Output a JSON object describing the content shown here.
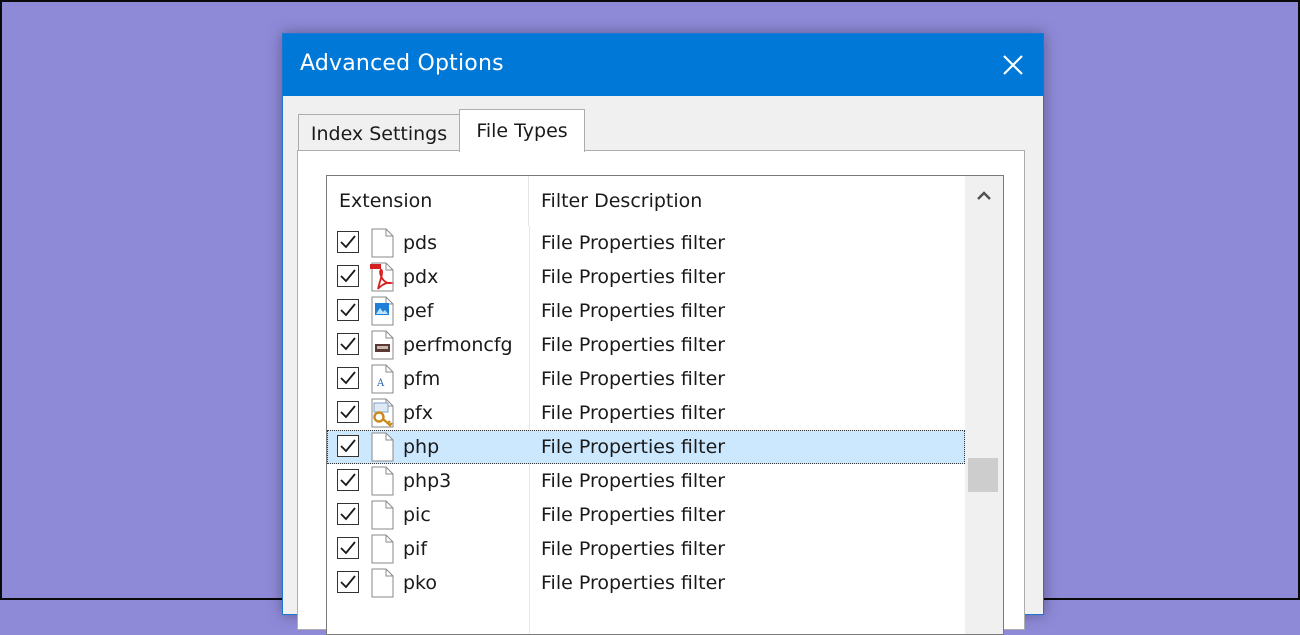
{
  "window": {
    "title": "Advanced Options"
  },
  "tabs": [
    {
      "label": "Index Settings",
      "active": false
    },
    {
      "label": "File Types",
      "active": true
    }
  ],
  "list": {
    "columns": [
      "Extension",
      "Filter Description"
    ],
    "rows": [
      {
        "ext": "pds",
        "desc": "File Properties filter",
        "checked": true,
        "icon": "blank-file-icon"
      },
      {
        "ext": "pdx",
        "desc": "File Properties filter",
        "checked": true,
        "icon": "pdf-file-icon"
      },
      {
        "ext": "pef",
        "desc": "File Properties filter",
        "checked": true,
        "icon": "image-file-icon"
      },
      {
        "ext": "perfmoncfg",
        "desc": "File Properties filter",
        "checked": true,
        "icon": "perfmon-file-icon"
      },
      {
        "ext": "pfm",
        "desc": "File Properties filter",
        "checked": true,
        "icon": "font-file-icon"
      },
      {
        "ext": "pfx",
        "desc": "File Properties filter",
        "checked": true,
        "icon": "certificate-key-icon"
      },
      {
        "ext": "php",
        "desc": "File Properties filter",
        "checked": true,
        "icon": "blank-file-icon",
        "selected": true
      },
      {
        "ext": "php3",
        "desc": "File Properties filter",
        "checked": true,
        "icon": "blank-file-icon"
      },
      {
        "ext": "pic",
        "desc": "File Properties filter",
        "checked": true,
        "icon": "blank-file-icon"
      },
      {
        "ext": "pif",
        "desc": "File Properties filter",
        "checked": true,
        "icon": "blank-file-icon"
      },
      {
        "ext": "pko",
        "desc": "File Properties filter",
        "checked": true,
        "icon": "blank-file-icon"
      }
    ]
  },
  "colors": {
    "titlebar": "#0078d7",
    "background": "#8f8ad8",
    "selection": "#cce8ff"
  }
}
